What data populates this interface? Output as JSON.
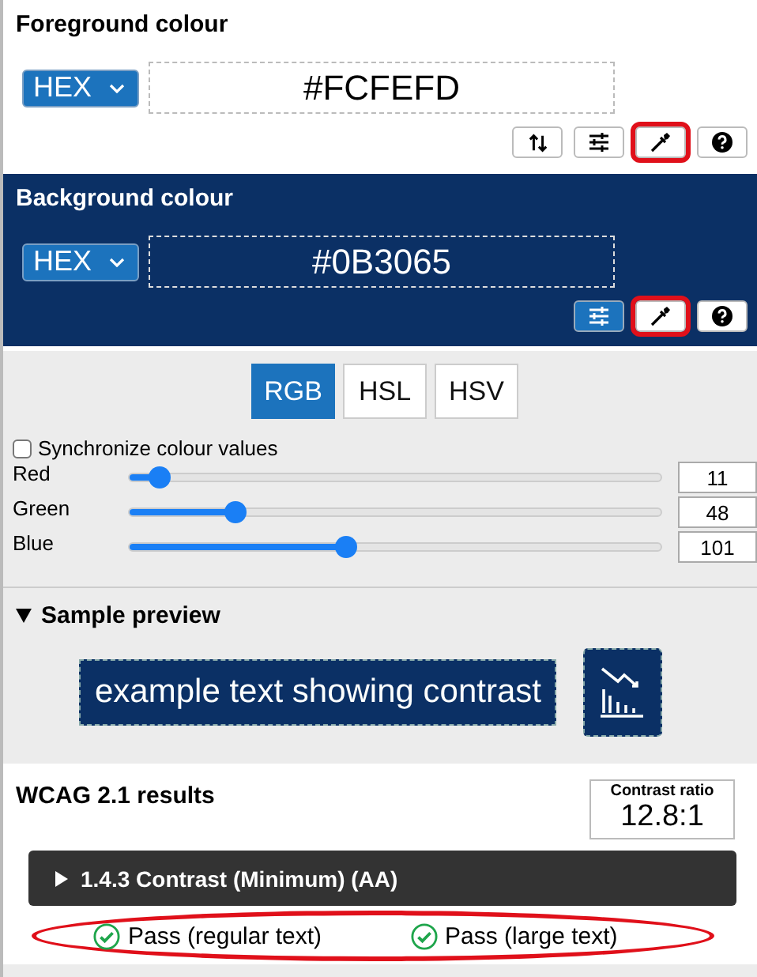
{
  "foreground": {
    "title": "Foreground colour",
    "format": "HEX",
    "value": "#FCFEFD",
    "tools": [
      {
        "kind": "swap",
        "selected": false,
        "highlighted": false
      },
      {
        "kind": "sliders",
        "selected": false,
        "highlighted": false
      },
      {
        "kind": "eyedropper",
        "selected": false,
        "highlighted": true
      },
      {
        "kind": "help",
        "selected": false,
        "highlighted": false
      }
    ]
  },
  "background": {
    "title": "Background colour",
    "format": "HEX",
    "value": "#0B3065",
    "tools": [
      {
        "kind": "sliders",
        "selected": true,
        "highlighted": false
      },
      {
        "kind": "eyedropper",
        "selected": false,
        "highlighted": true
      },
      {
        "kind": "help",
        "selected": false,
        "highlighted": false
      }
    ]
  },
  "model_tabs": [
    {
      "label": "RGB",
      "selected": true
    },
    {
      "label": "HSL",
      "selected": false
    },
    {
      "label": "HSV",
      "selected": false
    }
  ],
  "sync": {
    "label": "Synchronize colour values",
    "checked": false
  },
  "channels": [
    {
      "name": "Red",
      "level": 0.043,
      "value": "11"
    },
    {
      "name": "Green",
      "level": 0.188,
      "value": "48"
    },
    {
      "name": "Blue",
      "level": 0.396,
      "value": "101"
    }
  ],
  "preview": {
    "title": "Sample preview",
    "expanded": true,
    "sample_text": "example text showing contrast"
  },
  "results": {
    "title": "WCAG 2.1 results",
    "ratio_label": "Contrast ratio",
    "ratio": "12.8:1",
    "criterion": {
      "label": "1.4.3 Contrast (Minimum) (AA)",
      "expanded": false
    },
    "highlighted": true,
    "checks": [
      {
        "label": "Pass (regular text)",
        "passed": true
      },
      {
        "label": "Pass (large text)",
        "passed": true
      }
    ]
  }
}
